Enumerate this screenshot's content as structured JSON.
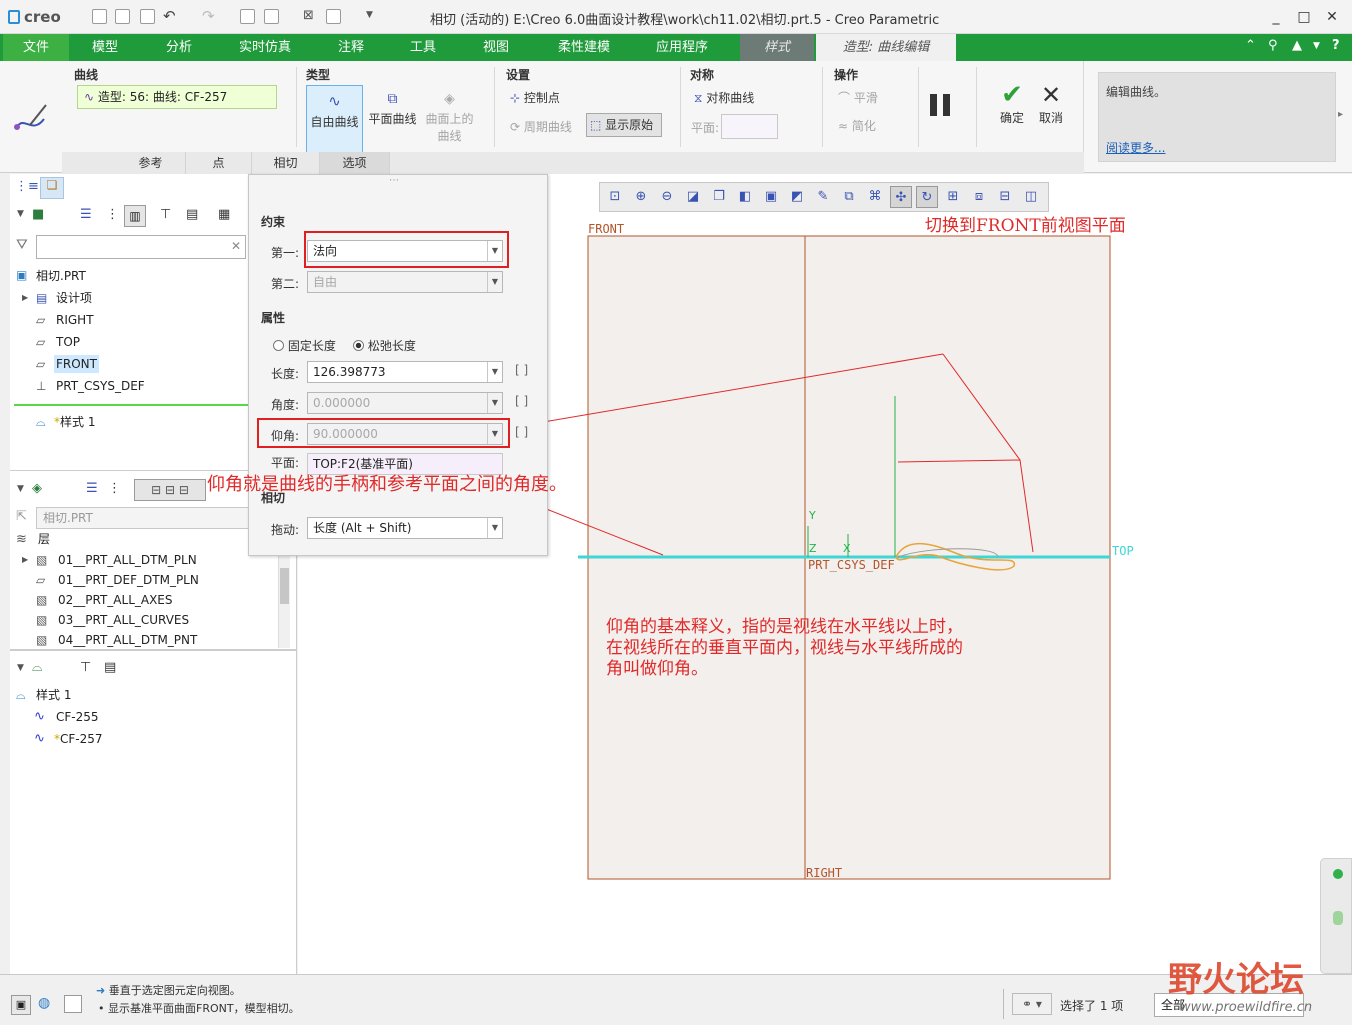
{
  "app": {
    "logo": "creo",
    "title": "相切 (活动的) E:\\Creo 6.0曲面设计教程\\work\\ch11.02\\相切.prt.5 - Creo Parametric"
  },
  "window_controls": [
    "_",
    "□",
    "✕"
  ],
  "menus": [
    "文件",
    "模型",
    "分析",
    "实时仿真",
    "注释",
    "工具",
    "视图",
    "柔性建模",
    "应用程序",
    "样式",
    "造型: 曲线编辑"
  ],
  "ribbon": {
    "curve_group": {
      "title": "曲线",
      "value": "造型: 56: 曲线: CF-257"
    },
    "type_group": {
      "title": "类型",
      "free": "自由曲线",
      "planar": "平面曲线",
      "cos_line1": "曲面上的",
      "cos_line2": "曲线"
    },
    "settings_group": {
      "title": "设置",
      "control_point": "控制点",
      "periodic": "周期曲线",
      "show_original": "显示原始"
    },
    "symmetry_group": {
      "title": "对称",
      "sym_curve": "对称曲线",
      "plane_label": "平面:"
    },
    "ops_group": {
      "title": "操作",
      "smooth": "平滑",
      "simplify": "简化"
    },
    "ok": "确定",
    "cancel": "取消",
    "help_text": "编辑曲线。",
    "read_more": "阅读更多..."
  },
  "subtabs": [
    "参考",
    "点",
    "相切",
    "选项"
  ],
  "options_panel": {
    "constraint_title": "约束",
    "first_label": "第一:",
    "first_value": "法向",
    "second_label": "第二:",
    "second_value": "自由",
    "attr_title": "属性",
    "fixed_length": "固定长度",
    "relax_length": "松弛长度",
    "length_label": "长度:",
    "length_value": "126.398773",
    "angle_label": "角度:",
    "angle_value": "0.000000",
    "elev_label": "仰角:",
    "elev_value": "90.000000",
    "plane_label": "平面:",
    "plane_value": "TOP:F2(基准平面)",
    "tangent_title": "相切",
    "drag_label": "拖动:",
    "drag_value": "长度 (Alt + Shift)"
  },
  "model_tree": {
    "root": "相切.PRT",
    "items": [
      "设计项",
      "RIGHT",
      "TOP",
      "FRONT",
      "PRT_CSYS_DEF"
    ],
    "style_item": "样式 1"
  },
  "layer_tree": {
    "combo": "相切.PRT",
    "header": "层",
    "items": [
      "01__PRT_ALL_DTM_PLN",
      "01__PRT_DEF_DTM_PLN",
      "02__PRT_ALL_AXES",
      "03__PRT_ALL_CURVES",
      "04__PRT_ALL_DTM_PNT"
    ]
  },
  "style_tree": {
    "root": "样式 1",
    "items": [
      "CF-255",
      "CF-257"
    ]
  },
  "canvas": {
    "front": "FRONT",
    "top": "TOP",
    "right": "RIGHT",
    "csys": "PRT_CSYS_DEF",
    "axis_y": "Y",
    "axis_z": "Z",
    "axis_x": "X"
  },
  "annotations": {
    "switch_view": "切换到FRONT前视图平面",
    "elev_meaning": "仰角就是曲线的手柄和参考平面之间的角度。",
    "def_line1": "仰角的基本释义，指的是视线在水平线以上时，",
    "def_line2": "在视线所在的垂直平面内，视线与水平线所成的",
    "def_line3": "角叫做仰角。"
  },
  "status": {
    "line1": "垂直于选定图元定向视图。",
    "line2": "显示基准平面曲面FRONT，模型相切。",
    "selected": "选择了 1 项",
    "filter": "全部"
  },
  "watermark": {
    "text": "野火论坛",
    "url": "www.proewildfire.cn"
  },
  "colors": {
    "menubar": "#1f9b3b",
    "annotation": "#e02a2a",
    "top_plane": "#3fd6d6",
    "datum": "#b2552b"
  }
}
